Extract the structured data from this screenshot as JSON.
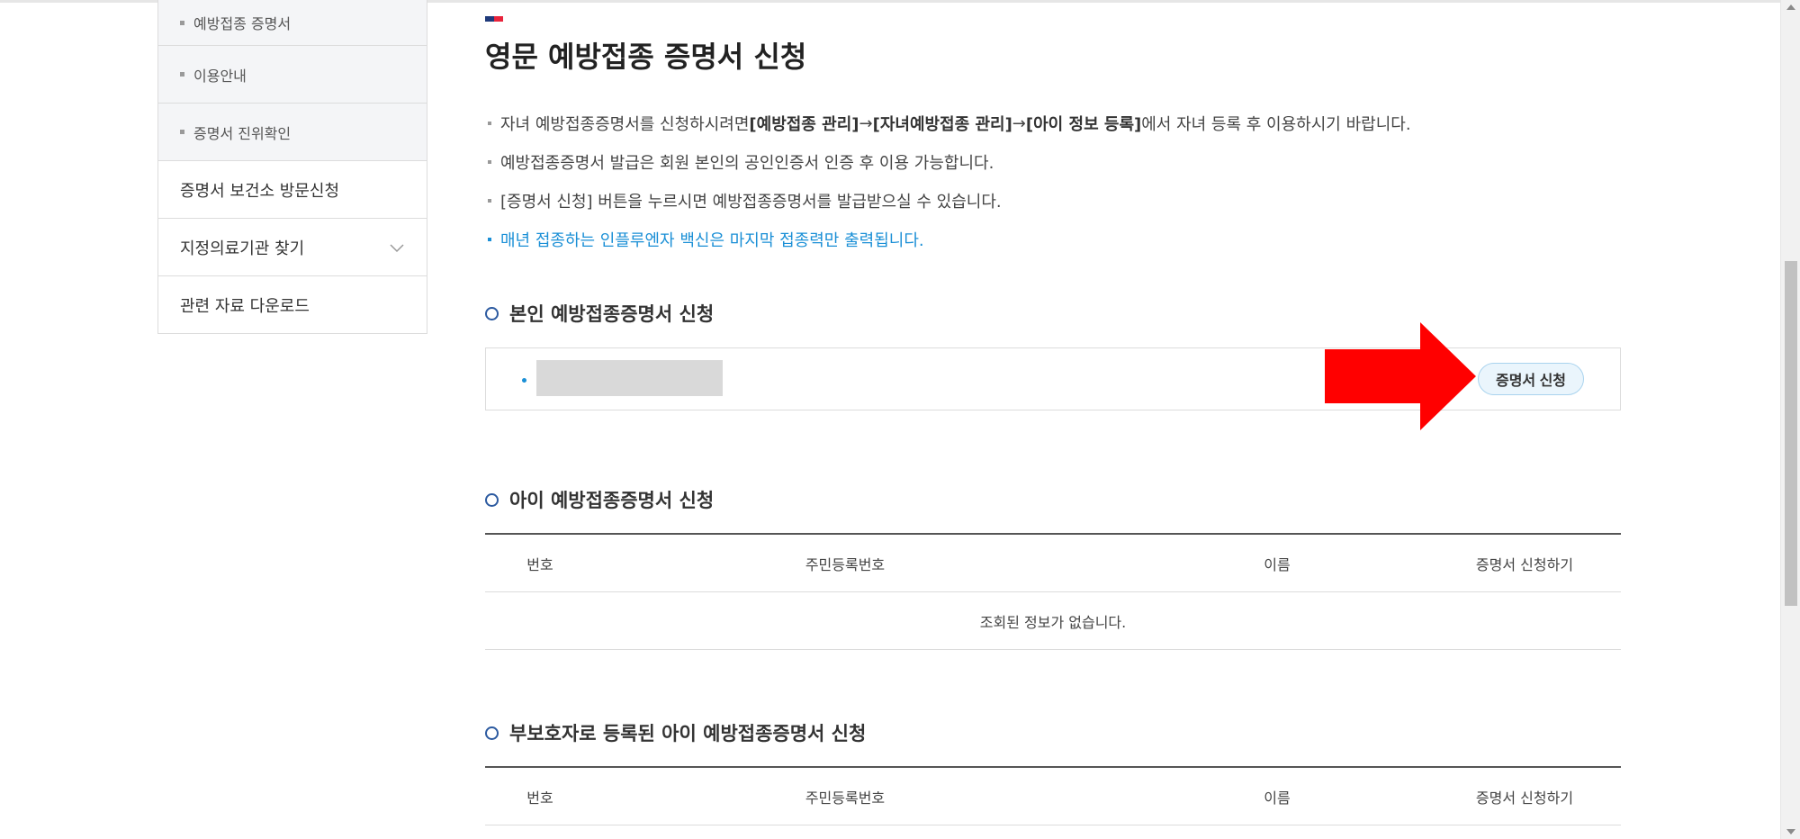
{
  "sidebar": {
    "sub_items": [
      {
        "label": "예방접종 증명서"
      },
      {
        "label": "이용안내"
      },
      {
        "label": "증명서 진위확인"
      }
    ],
    "main_items": [
      {
        "label": "증명서 보건소 방문신청"
      },
      {
        "label": "지정의료기관 찾기"
      },
      {
        "label": "관련 자료 다운로드"
      }
    ]
  },
  "page": {
    "title": "영문 예방접종 증명서 신청"
  },
  "notices": {
    "n1": {
      "pre": "자녀 예방접종증명서를 신청하시려면 ",
      "b1": "[예방접종 관리]",
      "arrow1": " → ",
      "b2": "[자녀예방접종 관리]",
      "arrow2": " → ",
      "b3": "[아이 정보 등록]",
      "post": "에서 자녀 등록 후 이용하시기 바랍니다."
    },
    "n2": "예방접종증명서 발급은 회원 본인의 공인인증서 인증 후 이용 가능합니다.",
    "n3": "[증명서 신청] 버튼을 누르시면 예방접종증명서를 발급받으실 수 있습니다.",
    "n4": "매년 접종하는 인플루엔자 백신은 마지막 접종력만 출력됩니다."
  },
  "sections": {
    "self": {
      "title": "본인 예방접종증명서 신청",
      "button_label": "증명서 신청"
    },
    "child": {
      "title": "아이 예방접종증명서 신청",
      "headers": [
        "번호",
        "주민등록번호",
        "이름",
        "증명서 신청하기"
      ],
      "empty_message": "조회된 정보가 없습니다."
    },
    "guardian": {
      "title": "부보호자로 등록된 아이 예방접종증명서 신청",
      "headers": [
        "번호",
        "주민등록번호",
        "이름",
        "증명서 신청하기"
      ]
    }
  },
  "colors": {
    "accent_blue": "#1a8fd6",
    "section_circle": "#2c5aa0",
    "arrow_red": "#ff0000"
  },
  "icons": {
    "chevron": "chevron-down-icon",
    "section_marker": "circle-outline-icon",
    "annotation": "red-arrow-icon"
  }
}
